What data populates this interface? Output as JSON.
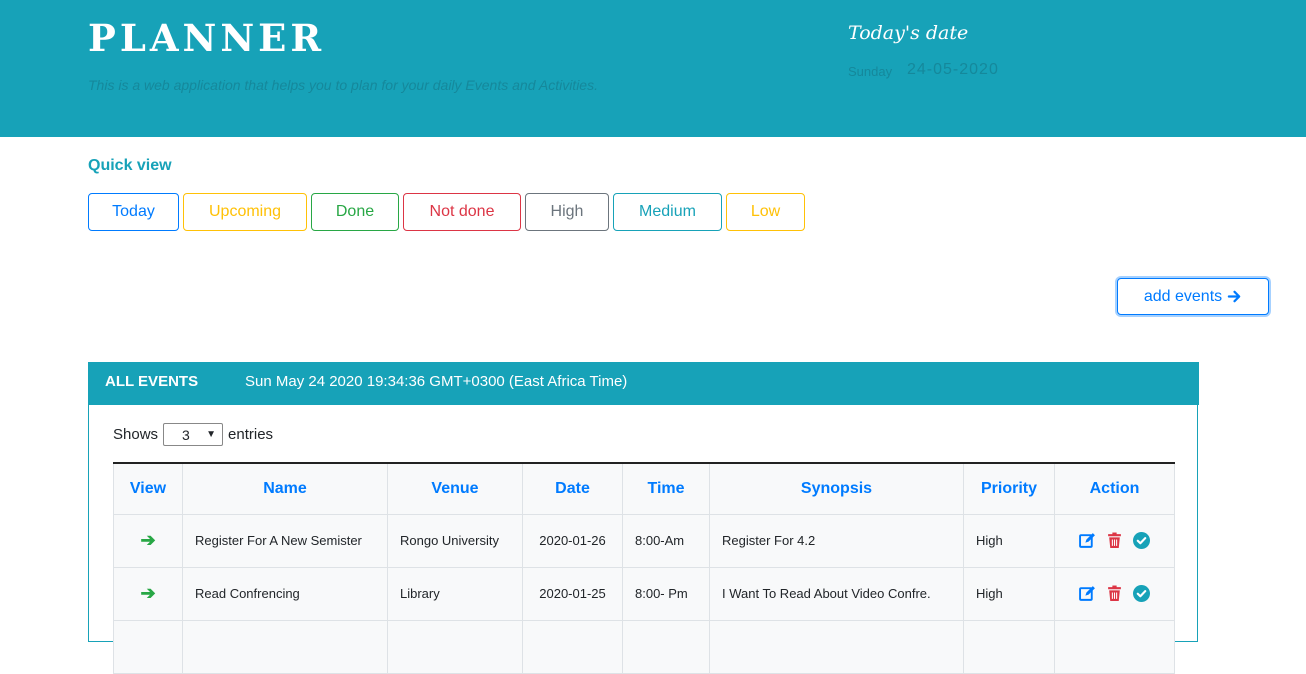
{
  "header": {
    "brand": "PLANNER",
    "tagline": "This is a web application that helps you to plan for your daily Events and Activities.",
    "today_label": "Today's date",
    "today_day": "Sunday",
    "today_date": "24-05-2020"
  },
  "quick_view": {
    "title": "Quick view",
    "filters": [
      {
        "label": "Today",
        "color": "#007bff"
      },
      {
        "label": "Upcoming",
        "color": "#ffc107"
      },
      {
        "label": "Done",
        "color": "#28a745"
      },
      {
        "label": "Not done",
        "color": "#dc3545"
      },
      {
        "label": "High",
        "color": "#6c757d"
      },
      {
        "label": "Medium",
        "color": "#17a2b8"
      },
      {
        "label": "Low",
        "color": "#ffc107"
      }
    ]
  },
  "add_events": {
    "label": "add events",
    "icon": "arrow-right-icon"
  },
  "events_card": {
    "title": "ALL EVENTS",
    "clock": "Sun May 24 2020 19:34:36 GMT+0300 (East Africa Time)",
    "shows_label": "Shows",
    "entries_value": "3",
    "entries_label": "entries",
    "columns": [
      "View",
      "Name",
      "Venue",
      "Date",
      "Time",
      "Synopsis",
      "Priority",
      "Action"
    ],
    "rows": [
      {
        "name": "Register For A New Semister",
        "venue": "Rongo University",
        "date": "2020-01-26",
        "time": "8:00-Am",
        "synopsis": "Register For 4.2",
        "priority": "High"
      },
      {
        "name": "Read Confrencing",
        "venue": "Library",
        "date": "2020-01-25",
        "time": "8:00- Pm",
        "synopsis": "I Want To Read About Video Confre.",
        "priority": "High"
      },
      {
        "name": "",
        "venue": "",
        "date": "",
        "time": "",
        "synopsis": "",
        "priority": ""
      }
    ]
  },
  "colors": {
    "accent": "#17a2b8",
    "primary": "#007bff",
    "success": "#28a745",
    "danger": "#dc3545"
  }
}
